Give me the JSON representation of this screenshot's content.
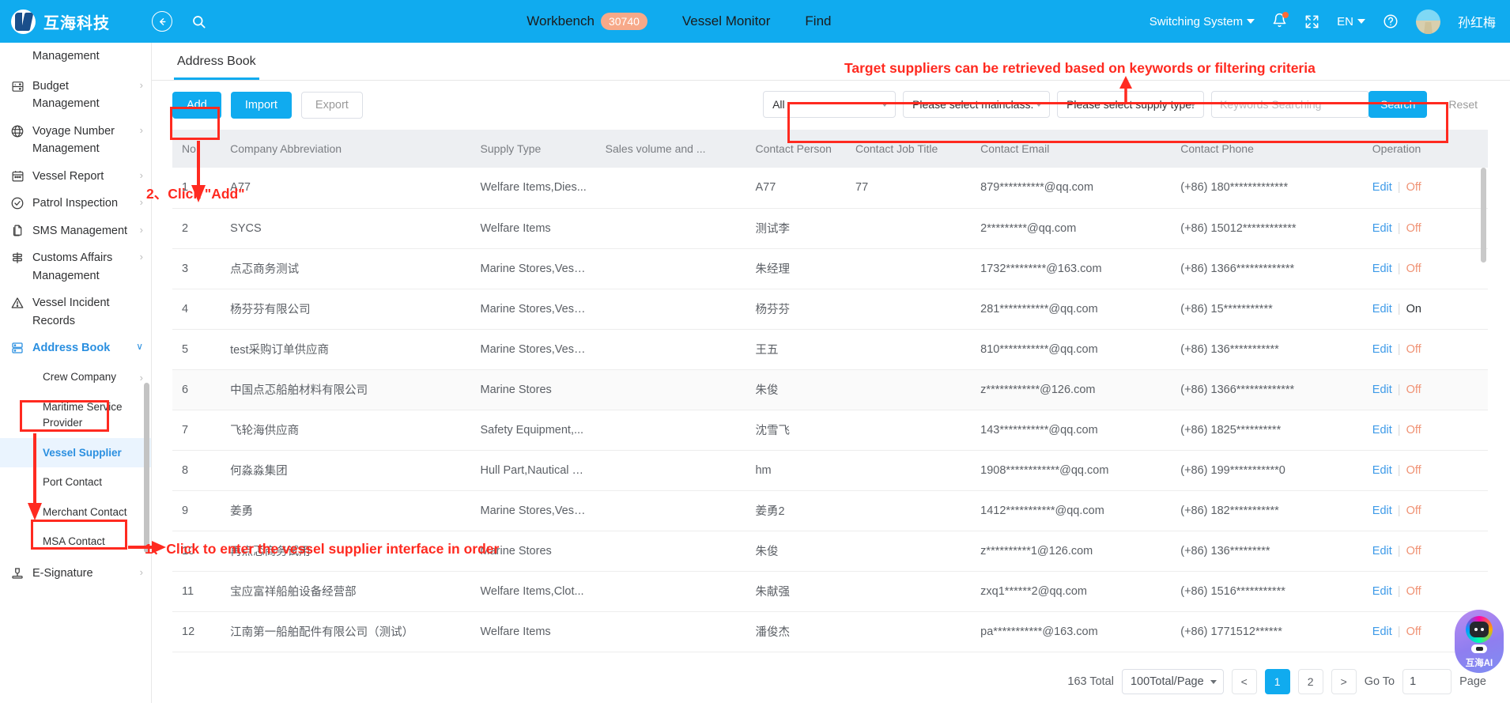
{
  "header": {
    "brand_name": "互海科技",
    "back_icon": "back-arrow-icon",
    "search_icon": "search-icon",
    "nav": [
      {
        "label": "Workbench",
        "badge": "30740"
      },
      {
        "label": "Vessel Monitor",
        "badge": ""
      },
      {
        "label": "Find",
        "badge": ""
      }
    ],
    "switching_system": "Switching System",
    "language": "EN",
    "user_name": "孙红梅"
  },
  "sidebar": {
    "items": [
      {
        "label": "Management",
        "icon": "",
        "arrow": "",
        "orphan": true
      },
      {
        "label": "Budget Management",
        "icon": "budget-icon",
        "arrow": "›"
      },
      {
        "label": "Voyage Number Management",
        "icon": "globe-icon",
        "arrow": "›"
      },
      {
        "label": "Vessel Report",
        "icon": "calendar-icon",
        "arrow": "›"
      },
      {
        "label": "Patrol Inspection",
        "icon": "check-circle-icon",
        "arrow": "›"
      },
      {
        "label": "SMS Management",
        "icon": "documents-icon",
        "arrow": "›"
      },
      {
        "label": "Customs Affairs Management",
        "icon": "customs-icon",
        "arrow": "›"
      },
      {
        "label": "Vessel Incident Records",
        "icon": "warning-icon",
        "arrow": ""
      },
      {
        "label": "Address Book",
        "icon": "address-book-icon",
        "arrow": "∨",
        "active": true
      }
    ],
    "sub_items": [
      {
        "label": "Crew Company",
        "arrow": "›"
      },
      {
        "label": "Maritime Service Provider",
        "arrow": ""
      },
      {
        "label": "Vessel Supplier",
        "arrow": "",
        "active": true
      },
      {
        "label": "Port Contact",
        "arrow": ""
      },
      {
        "label": "Merchant Contact",
        "arrow": ""
      },
      {
        "label": "MSA Contact",
        "arrow": ""
      }
    ],
    "footer_item": {
      "label": "E-Signature",
      "icon": "signature-icon",
      "arrow": "›"
    }
  },
  "main": {
    "tab": "Address Book",
    "toolbar": {
      "add_label": "Add",
      "import_label": "Import",
      "export_label": "Export"
    },
    "filters": {
      "select_all": "All",
      "select_mainclass": "Please select mainclass.",
      "select_supply_type": "Please select supply type.",
      "keywords_placeholder": "Keywords Searching",
      "keywords_value": "",
      "search_label": "Search",
      "reset_label": "Reset"
    },
    "table": {
      "columns": [
        "No.",
        "Company Abbreviation",
        "Supply Type",
        "Sales volume and ...",
        "Contact Person",
        "Contact Job Title",
        "Contact Email",
        "Contact Phone",
        "Operation"
      ],
      "rows": [
        {
          "no": "1",
          "company": "A77",
          "supply": "Welfare Items,Dies...",
          "sales": "",
          "person": "A77",
          "job": "77",
          "email": "879**********@qq.com",
          "phone": "(+86) 180*************",
          "edit": "Edit",
          "status": "Off"
        },
        {
          "no": "2",
          "company": "SYCS",
          "supply": "Welfare Items",
          "sales": "",
          "person": "测试李",
          "job": "",
          "email": "2*********@qq.com",
          "phone": "(+86) 15012************",
          "edit": "Edit",
          "status": "Off"
        },
        {
          "no": "3",
          "company": "点忑商务测试",
          "supply": "Marine Stores,Vess...",
          "sales": "",
          "person": "朱经理",
          "job": "",
          "email": "1732*********@163.com",
          "phone": "(+86) 1366*************",
          "edit": "Edit",
          "status": "Off"
        },
        {
          "no": "4",
          "company": "杨芬芬有限公司",
          "supply": "Marine Stores,Vess...",
          "sales": "",
          "person": "杨芬芬",
          "job": "",
          "email": "281***********@qq.com",
          "phone": "(+86) 15***********",
          "edit": "Edit",
          "status": "On"
        },
        {
          "no": "5",
          "company": "test采购订单供应商",
          "supply": "Marine Stores,Vess...",
          "sales": "",
          "person": "王五",
          "job": "",
          "email": "810***********@qq.com",
          "phone": "(+86) 136***********",
          "edit": "Edit",
          "status": "Off"
        },
        {
          "no": "6",
          "company": "中国点忑船舶材料有限公司",
          "supply": "Marine Stores",
          "sales": "",
          "person": "朱俊",
          "job": "",
          "email": "z************@126.com",
          "phone": "(+86) 1366*************",
          "edit": "Edit",
          "status": "Off",
          "hover": true
        },
        {
          "no": "7",
          "company": "飞轮海供应商",
          "supply": "Safety Equipment,...",
          "sales": "",
          "person": "沈雪飞",
          "job": "",
          "email": "143***********@qq.com",
          "phone": "(+86) 1825**********",
          "edit": "Edit",
          "status": "Off"
        },
        {
          "no": "8",
          "company": "何淼淼集团",
          "supply": "Hull Part,Nautical C...",
          "sales": "",
          "person": "hm",
          "job": "",
          "email": "1908************@qq.com",
          "phone": "(+86) 199***********0",
          "edit": "Edit",
          "status": "Off"
        },
        {
          "no": "9",
          "company": "姜勇",
          "supply": "Marine Stores,Vess...",
          "sales": "",
          "person": "姜勇2",
          "job": "",
          "email": "1412***********@qq.com",
          "phone": "(+86) 182***********",
          "edit": "Edit",
          "status": "Off"
        },
        {
          "no": "10",
          "company": "再点忑商务试用",
          "supply": "Marine Stores",
          "sales": "",
          "person": "朱俊",
          "job": "",
          "email": "z**********1@126.com",
          "phone": "(+86) 136*********",
          "edit": "Edit",
          "status": "Off"
        },
        {
          "no": "11",
          "company": "宝应富祥船舶设备经营部",
          "supply": "Welfare Items,Clot...",
          "sales": "",
          "person": "朱献强",
          "job": "",
          "email": "zxq1******2@qq.com",
          "phone": "(+86) 1516***********",
          "edit": "Edit",
          "status": "Off"
        },
        {
          "no": "12",
          "company": "江南第一船舶配件有限公司（测试）",
          "supply": "Welfare Items",
          "sales": "",
          "person": "潘俊杰",
          "job": "",
          "email": "pa***********@163.com",
          "phone": "(+86) 1771512******",
          "edit": "Edit",
          "status": "Off"
        }
      ]
    },
    "pagination": {
      "total": "163 Total",
      "page_size": "100Total/Page",
      "prev": "<",
      "pages": [
        "1",
        "2"
      ],
      "next": ">",
      "goto_label": "Go To",
      "goto_value": "1",
      "page_word": "Page"
    }
  },
  "annotations": {
    "step1": "1、Click to enter the vessel supplier interface in order",
    "step2": "2、Click \"Add\"",
    "filter_note": "Target suppliers can be retrieved based on keywords or filtering criteria"
  },
  "floating": {
    "ai_label": "互海AI"
  },
  "colors": {
    "brand_blue": "#10ABEF",
    "annotation_red": "#FF2A20",
    "badge_orange": "#F7A989",
    "link_blue": "#3d9ae8",
    "off_orange": "#F09274"
  }
}
